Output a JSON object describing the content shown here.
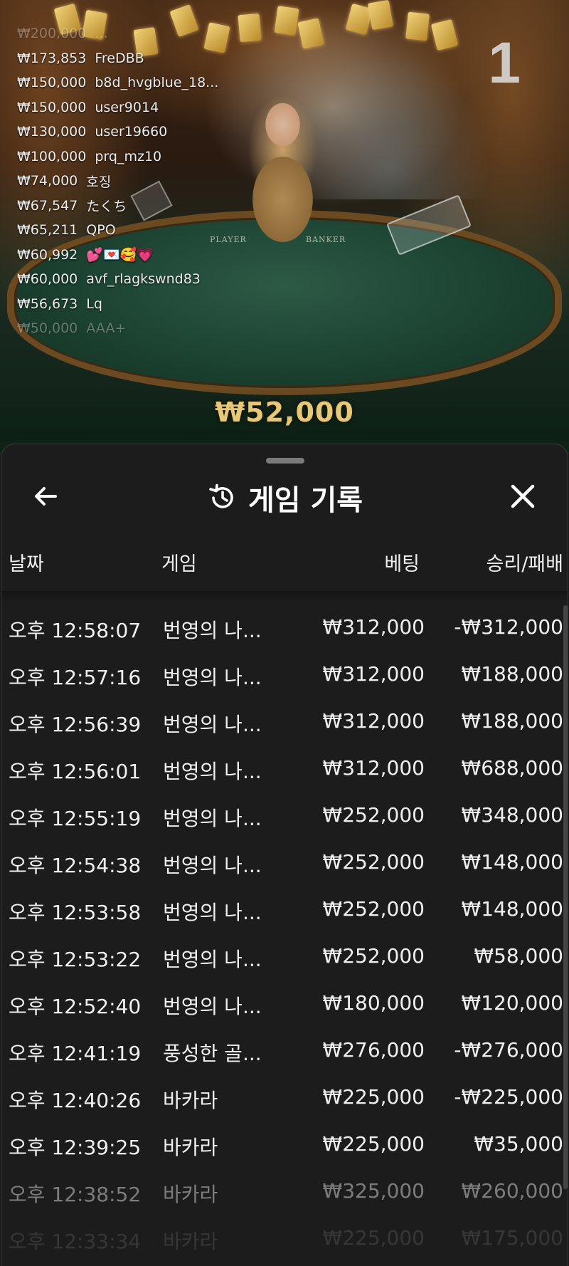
{
  "scene": {
    "round_number": "1",
    "felt_player": "PLAYER",
    "felt_banker": "BANKER",
    "win_amount": "₩52,000"
  },
  "leaderboard": [
    {
      "amount": "₩200,000",
      "name": "..."
    },
    {
      "amount": "₩173,853",
      "name": "FreDBB"
    },
    {
      "amount": "₩150,000",
      "name": "b8d_hvgblue_18..."
    },
    {
      "amount": "₩150,000",
      "name": "user9014"
    },
    {
      "amount": "₩130,000",
      "name": "user19660"
    },
    {
      "amount": "₩100,000",
      "name": "prq_mz10"
    },
    {
      "amount": "₩74,000",
      "name": "호징"
    },
    {
      "amount": "₩67,547",
      "name": "たくち"
    },
    {
      "amount": "₩65,211",
      "name": "QPO"
    },
    {
      "amount": "₩60,992",
      "name": "💕💌🥰💗"
    },
    {
      "amount": "₩60,000",
      "name": "avf_rlagkswnd83"
    },
    {
      "amount": "₩56,673",
      "name": "Lq"
    },
    {
      "amount": "₩50,000",
      "name": "AAA+"
    }
  ],
  "sheet": {
    "title": "게임 기록",
    "icons": {
      "back": "back-arrow-icon",
      "history": "history-icon",
      "close": "close-icon"
    },
    "columns": {
      "date": "날짜",
      "game": "게임",
      "bet": "베팅",
      "win_loss": "승리/패배"
    },
    "rows": [
      {
        "date": "오후 12:58:07",
        "game": "번영의 나...",
        "bet": "₩312,000",
        "result": "-₩312,000"
      },
      {
        "date": "오후 12:57:16",
        "game": "번영의 나...",
        "bet": "₩312,000",
        "result": "₩188,000"
      },
      {
        "date": "오후 12:56:39",
        "game": "번영의 나...",
        "bet": "₩312,000",
        "result": "₩188,000"
      },
      {
        "date": "오후 12:56:01",
        "game": "번영의 나...",
        "bet": "₩312,000",
        "result": "₩688,000"
      },
      {
        "date": "오후 12:55:19",
        "game": "번영의 나...",
        "bet": "₩252,000",
        "result": "₩348,000"
      },
      {
        "date": "오후 12:54:38",
        "game": "번영의 나...",
        "bet": "₩252,000",
        "result": "₩148,000"
      },
      {
        "date": "오후 12:53:58",
        "game": "번영의 나...",
        "bet": "₩252,000",
        "result": "₩148,000"
      },
      {
        "date": "오후 12:53:22",
        "game": "번영의 나...",
        "bet": "₩252,000",
        "result": "₩58,000"
      },
      {
        "date": "오후 12:52:40",
        "game": "번영의 나...",
        "bet": "₩180,000",
        "result": "₩120,000"
      },
      {
        "date": "오후 12:41:19",
        "game": "풍성한 골...",
        "bet": "₩276,000",
        "result": "-₩276,000"
      },
      {
        "date": "오후 12:40:26",
        "game": "바카라",
        "bet": "₩225,000",
        "result": "-₩225,000"
      },
      {
        "date": "오후 12:39:25",
        "game": "바카라",
        "bet": "₩225,000",
        "result": "₩35,000"
      },
      {
        "date": "오후 12:38:52",
        "game": "바카라",
        "bet": "₩325,000",
        "result": "₩260,000"
      },
      {
        "date": "오후 12:33:34",
        "game": "바카라",
        "bet": "₩225,000",
        "result": "₩175,000"
      }
    ]
  }
}
